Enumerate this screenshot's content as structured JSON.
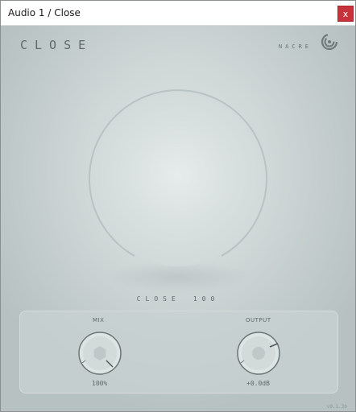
{
  "window": {
    "title": "Audio 1 / Close",
    "close_glyph": "x"
  },
  "plugin": {
    "title": "CLOSE",
    "brand": "NACRE",
    "logo_icon": "nacre-shell-icon",
    "version": "v0.1.3b"
  },
  "main_knob": {
    "readout_label": "CLOSE",
    "readout_value": "100"
  },
  "mix_knob": {
    "label": "MIX",
    "value": "100%"
  },
  "output_knob": {
    "label": "OUTPUT",
    "value": "+0.0dB"
  },
  "colors": {
    "close_button": "#c8323c",
    "background": "#bcc6c6",
    "text": "#606a6a"
  }
}
